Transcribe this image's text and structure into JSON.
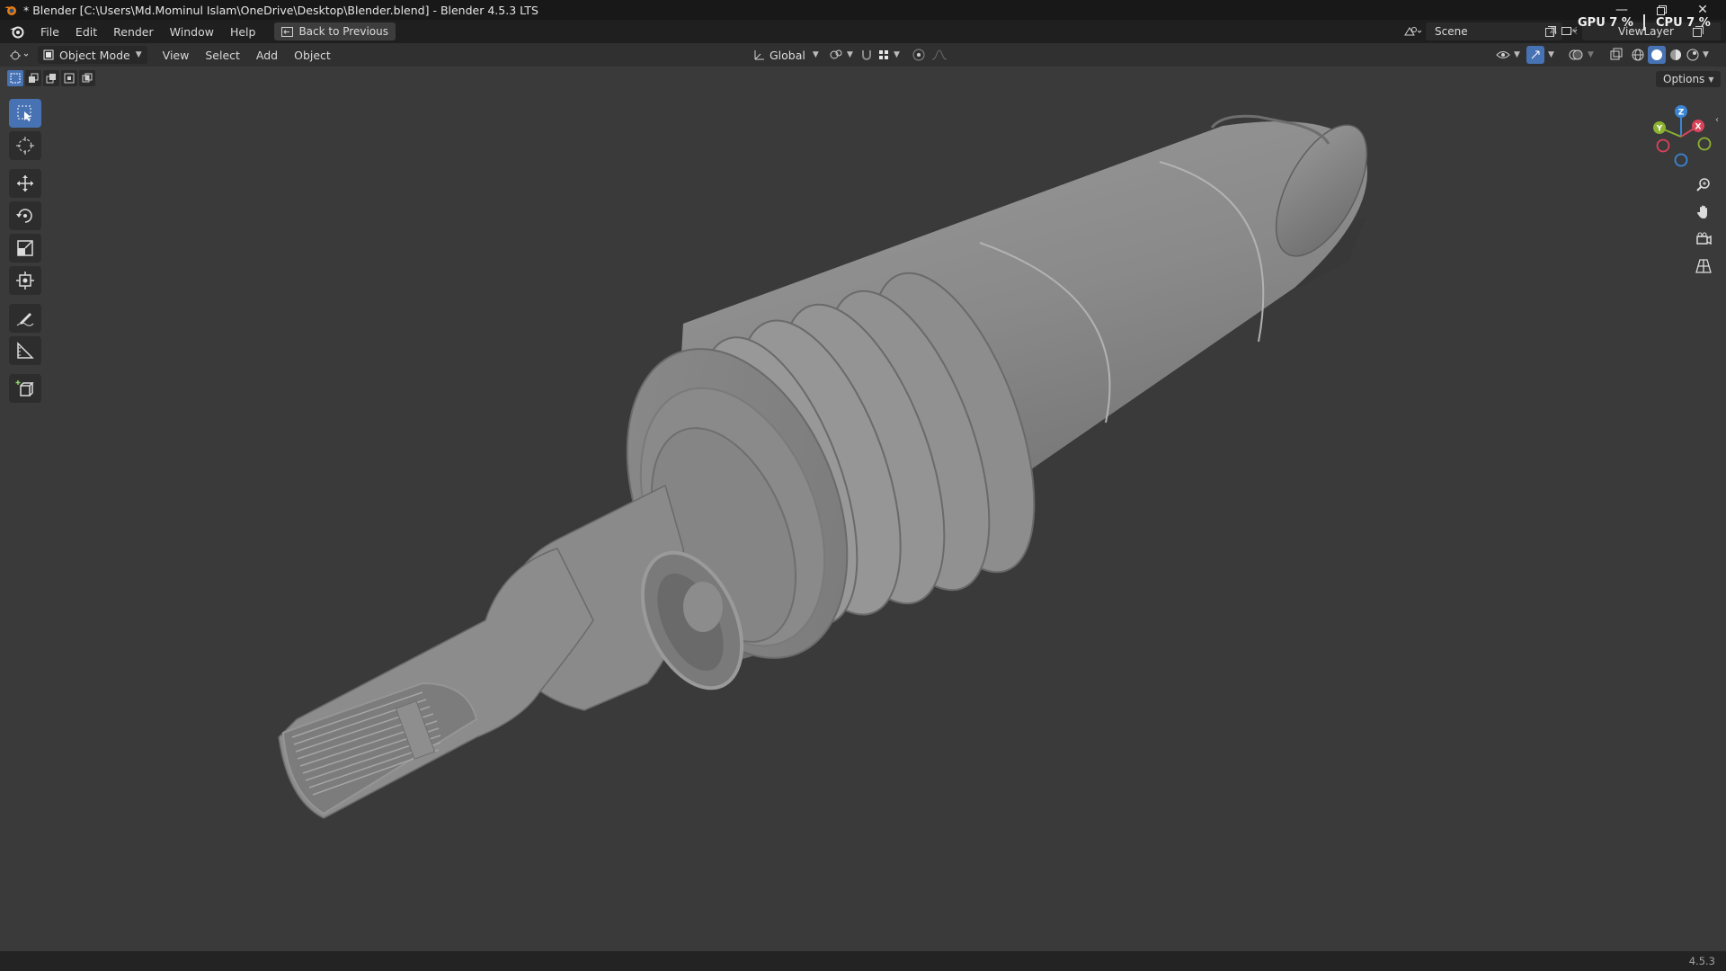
{
  "window": {
    "title": "* Blender [C:\\Users\\Md.Mominul Islam\\OneDrive\\Desktop\\Blender.blend] - Blender 4.5.3 LTS",
    "controls": [
      "minimize-icon",
      "restore-icon",
      "close-icon"
    ]
  },
  "menubar": {
    "items": [
      "File",
      "Edit",
      "Render",
      "Window",
      "Help"
    ],
    "back_button": "Back to Previous",
    "scene_label": "Scene",
    "viewlayer_label": "ViewLayer",
    "gpu_stat": "GPU   7 %",
    "cpu_stat": "CPU   7 %"
  },
  "viewport_header": {
    "mode": "Object Mode",
    "menus": [
      "View",
      "Select",
      "Add",
      "Object"
    ],
    "transform_orientation": "Global",
    "options_label": "Options"
  },
  "toolbar": {
    "tools": [
      "select-box",
      "cursor",
      "move",
      "rotate",
      "scale",
      "transform",
      "annotate",
      "measure",
      "add-cube"
    ],
    "active_tool": "select-box"
  },
  "gizmo": {
    "axes": [
      "Z",
      "Y",
      "X"
    ]
  },
  "statusbar": {
    "version": "4.5.3"
  },
  "colors": {
    "accent": "#4772b3",
    "axis_x": "#d9445a",
    "axis_y": "#8bb230",
    "axis_z": "#3a86d6",
    "viewport_bg": "#3a3a3a"
  }
}
